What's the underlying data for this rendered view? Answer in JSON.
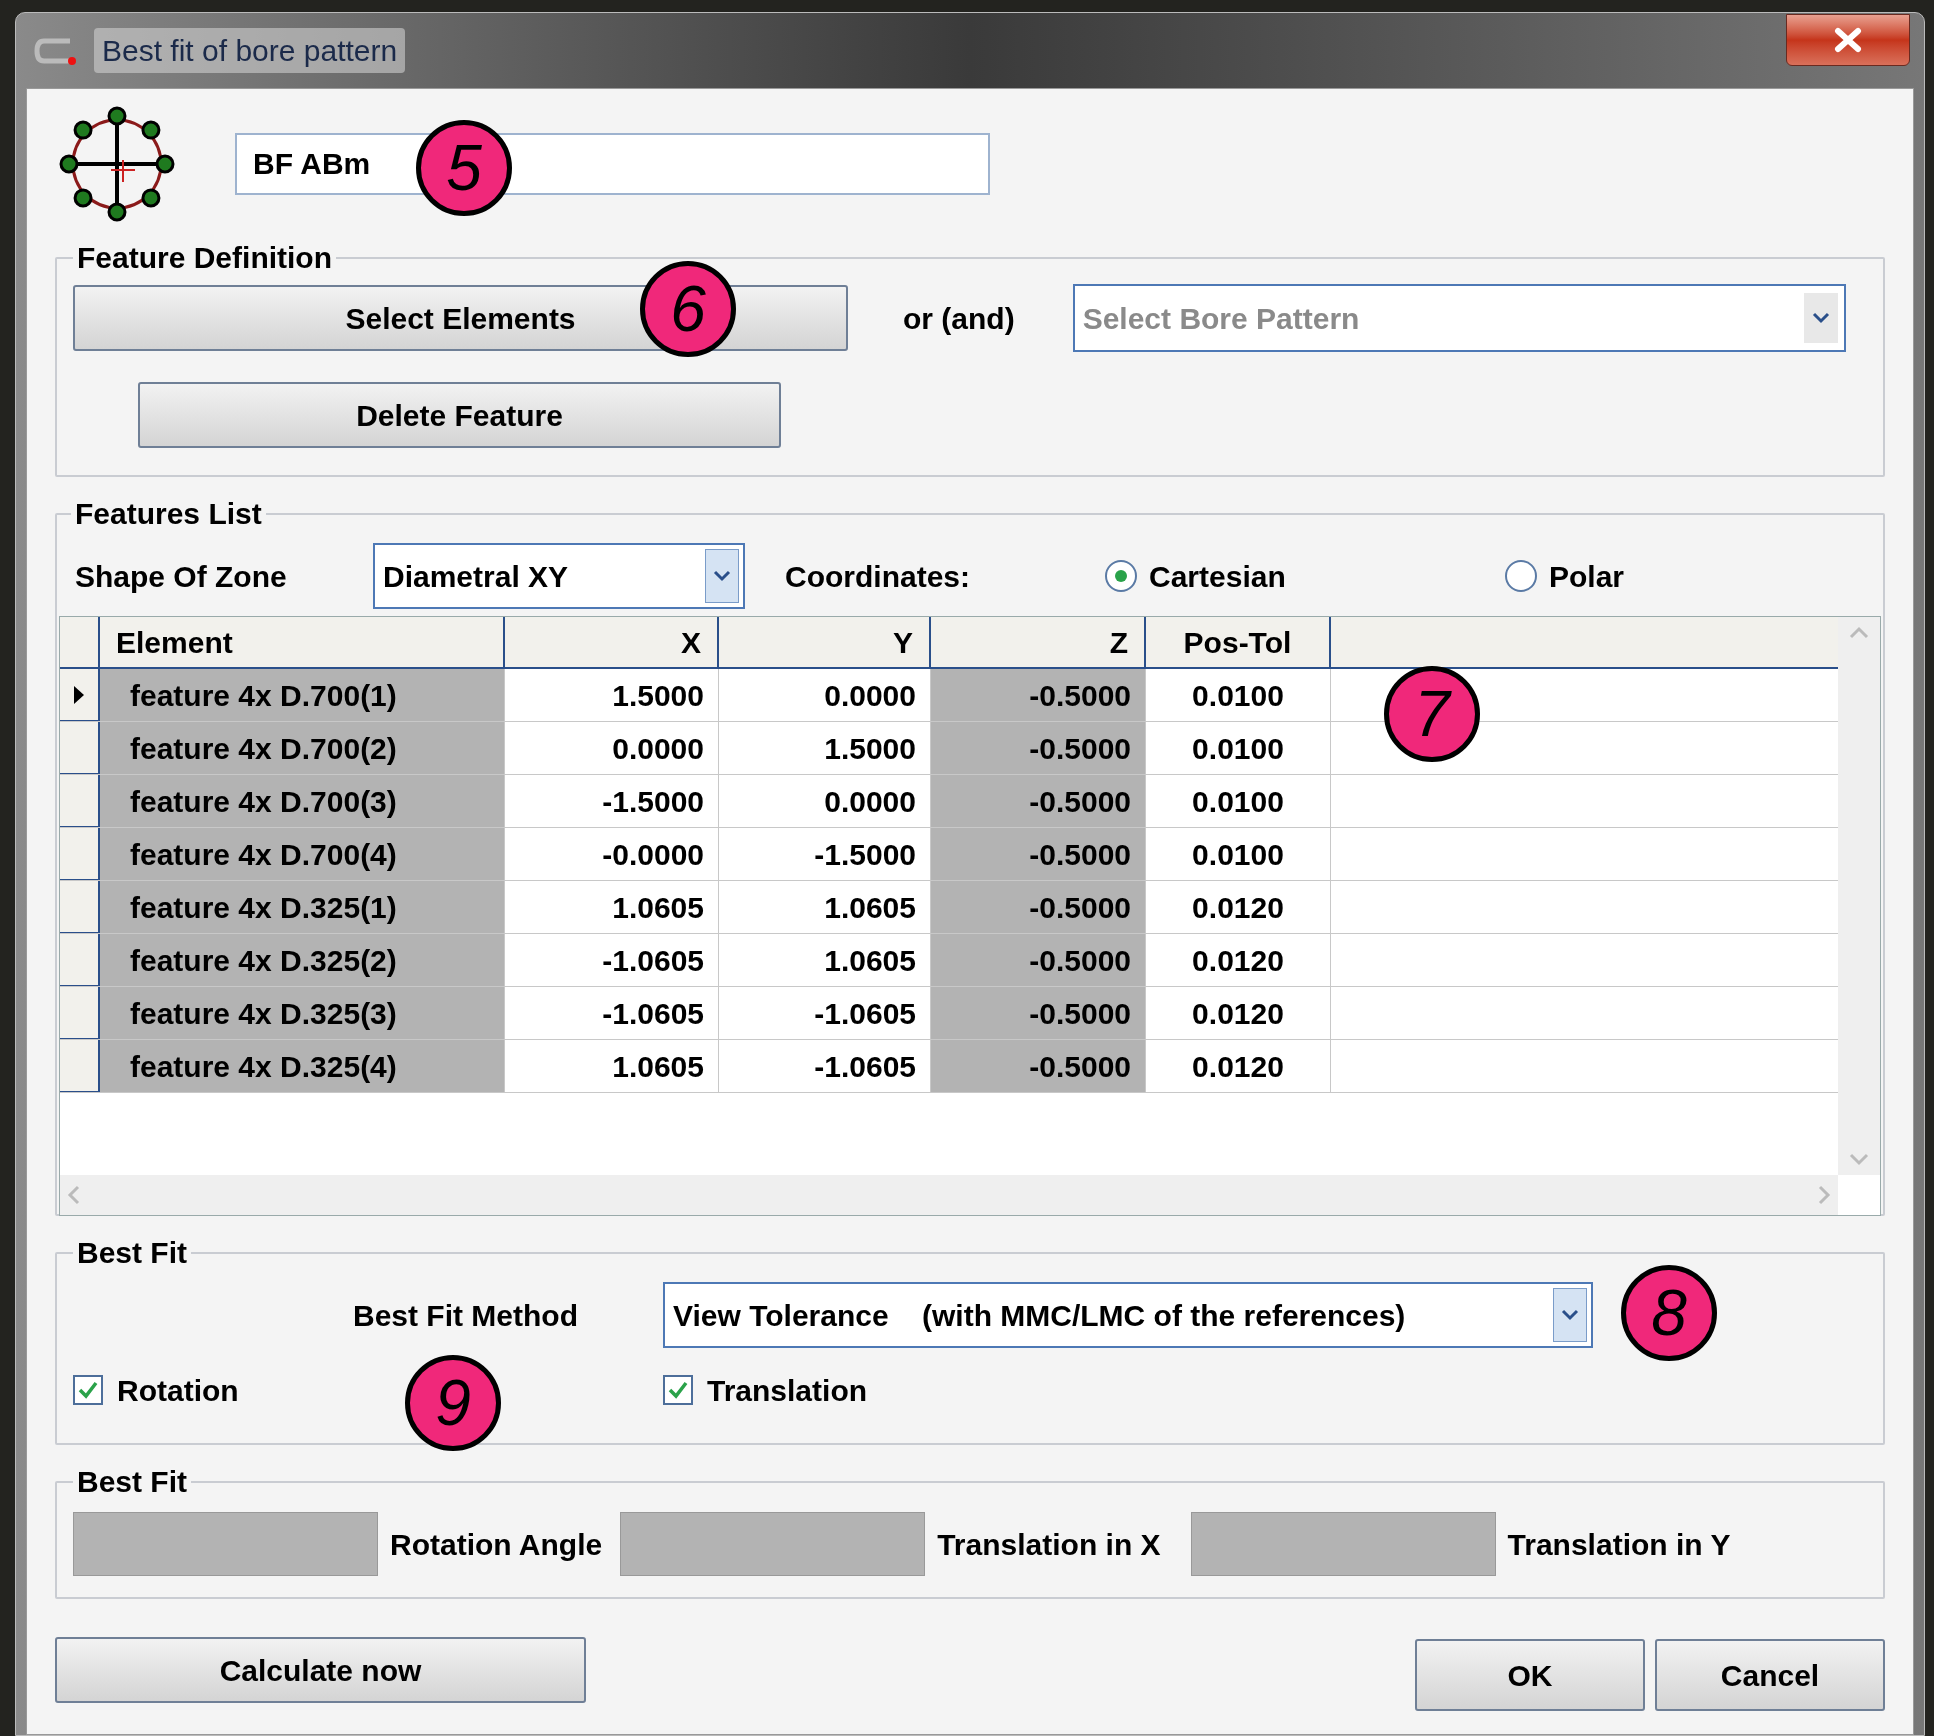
{
  "window": {
    "title": "Best fit of bore pattern"
  },
  "name_field": {
    "value": "BF ABm"
  },
  "feature_definition": {
    "title": "Feature Definition",
    "select_button": "Select Elements",
    "or_label": "or (and)",
    "bore_pattern": {
      "placeholder": "Select Bore Pattern"
    },
    "delete_button": "Delete Feature"
  },
  "features_list": {
    "title": "Features List",
    "shape_label": "Shape Of Zone",
    "shape_value": "Diametral XY",
    "coordinates_label": "Coordinates:",
    "coordinate_options": [
      {
        "label": "Cartesian",
        "selected": true
      },
      {
        "label": "Polar",
        "selected": false
      }
    ],
    "table": {
      "columns": [
        {
          "label": "Element",
          "readonly": true
        },
        {
          "label": "X",
          "readonly": false
        },
        {
          "label": "Y",
          "readonly": false
        },
        {
          "label": "Z",
          "readonly": true
        },
        {
          "label": "Pos-Tol",
          "readonly": false
        }
      ],
      "rows": [
        {
          "selected": true,
          "cells": [
            "feature 4x D.700(1)",
            "1.5000",
            "0.0000",
            "-0.5000",
            "0.0100"
          ]
        },
        {
          "selected": false,
          "cells": [
            "feature 4x D.700(2)",
            "0.0000",
            "1.5000",
            "-0.5000",
            "0.0100"
          ]
        },
        {
          "selected": false,
          "cells": [
            "feature 4x D.700(3)",
            "-1.5000",
            "0.0000",
            "-0.5000",
            "0.0100"
          ]
        },
        {
          "selected": false,
          "cells": [
            "feature 4x D.700(4)",
            "-0.0000",
            "-1.5000",
            "-0.5000",
            "0.0100"
          ]
        },
        {
          "selected": false,
          "cells": [
            "feature 4x D.325(1)",
            "1.0605",
            "1.0605",
            "-0.5000",
            "0.0120"
          ]
        },
        {
          "selected": false,
          "cells": [
            "feature 4x D.325(2)",
            "-1.0605",
            "1.0605",
            "-0.5000",
            "0.0120"
          ]
        },
        {
          "selected": false,
          "cells": [
            "feature 4x D.325(3)",
            "-1.0605",
            "-1.0605",
            "-0.5000",
            "0.0120"
          ]
        },
        {
          "selected": false,
          "cells": [
            "feature 4x D.325(4)",
            "1.0605",
            "-1.0605",
            "-0.5000",
            "0.0120"
          ]
        }
      ]
    }
  },
  "best_fit": {
    "title": "Best Fit",
    "method_label": "Best Fit Method",
    "method_value": "View Tolerance    (with MMC/LMC of the references)",
    "options": [
      {
        "label": "Rotation",
        "checked": true
      },
      {
        "label": "Translation",
        "checked": true
      }
    ]
  },
  "best_fit_results": {
    "title": "Best Fit",
    "fields": [
      {
        "label": "Rotation Angle"
      },
      {
        "label": "Translation in X"
      },
      {
        "label": "Translation in Y"
      }
    ]
  },
  "buttons": {
    "calculate": "Calculate now",
    "ok": "OK",
    "cancel": "Cancel"
  },
  "callouts": [
    {
      "label": "5"
    },
    {
      "label": "6"
    },
    {
      "label": "7"
    },
    {
      "label": "8"
    },
    {
      "label": "9"
    }
  ]
}
